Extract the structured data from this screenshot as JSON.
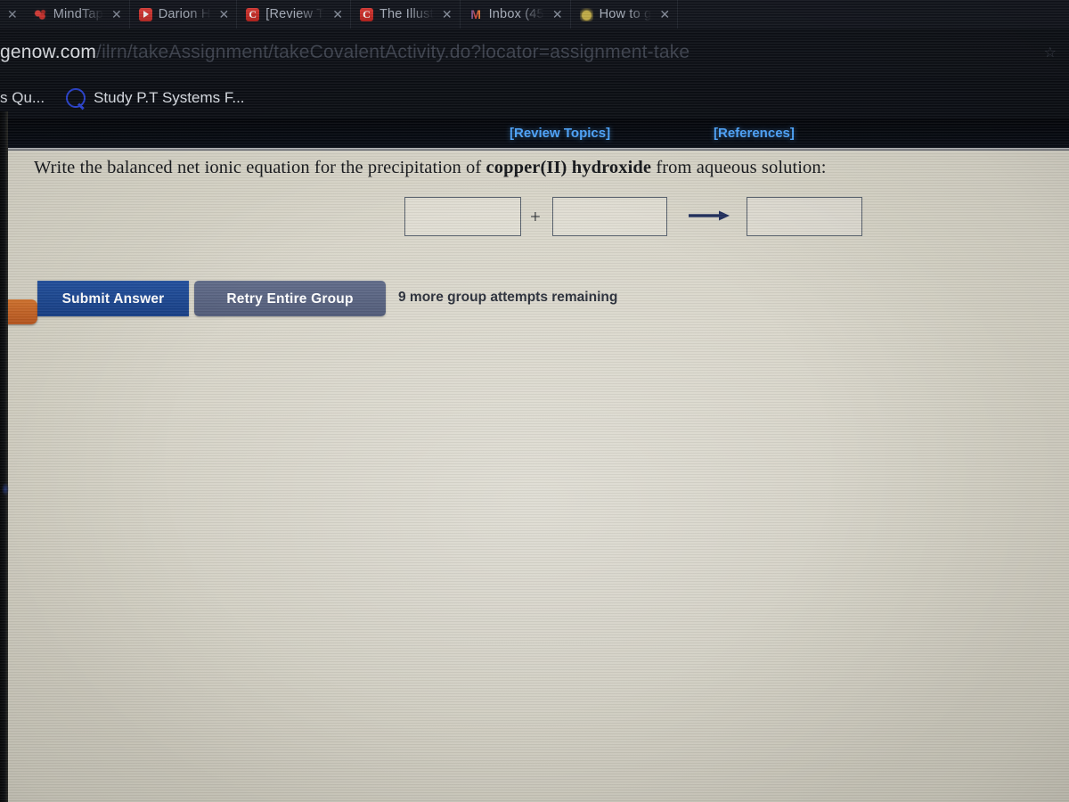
{
  "browser": {
    "tabs": [
      {
        "title": "MindTap",
        "favicon": "mindtap-icon",
        "close_label": "✕"
      },
      {
        "title": "Darion H",
        "favicon": "youtube-icon",
        "close_label": "✕"
      },
      {
        "title": "[Review T",
        "favicon": "chegg-icon",
        "close_label": "✕"
      },
      {
        "title": "The Illust",
        "favicon": "chegg-icon",
        "close_label": "✕"
      },
      {
        "title": "Inbox (45",
        "favicon": "gmail-icon",
        "close_label": "✕"
      },
      {
        "title": "How to g",
        "favicon": "generic-icon",
        "close_label": "✕"
      }
    ],
    "leading_close_label": "✕",
    "address": {
      "host": "genow.com",
      "path": "/ilrn/takeAssignment/takeCovalentActivity.do?locator=assignment-take",
      "right_icon": "☆"
    },
    "bookmarks": [
      {
        "label": "s Qu...",
        "icon": "none"
      },
      {
        "label": "Study P.T Systems F...",
        "icon": "quizlet-q-icon"
      }
    ]
  },
  "page": {
    "links": {
      "review_topics": "[Review Topics]",
      "references": "[References]"
    },
    "question": {
      "prefix": "Write the balanced net ionic equation for the precipitation of ",
      "bold": "copper(II) hydroxide",
      "suffix": " from aqueous solution:"
    },
    "equation": {
      "box1_value": "",
      "box2_value": "",
      "box3_value": "",
      "plus_symbol": "+",
      "arrow_symbol": "⟶"
    },
    "actions": {
      "submit_label": "Submit Answer",
      "retry_label": "Retry Entire Group",
      "attempts_text": "9 more group attempts remaining"
    }
  },
  "colors": {
    "submit_blue": "#1d4a95",
    "retry_gray": "#5a6484",
    "link_blue": "#4ea6ff",
    "page_bg": "#d8d5c9",
    "chrome_bg": "#11141c",
    "orange_tab": "#c2621f"
  }
}
